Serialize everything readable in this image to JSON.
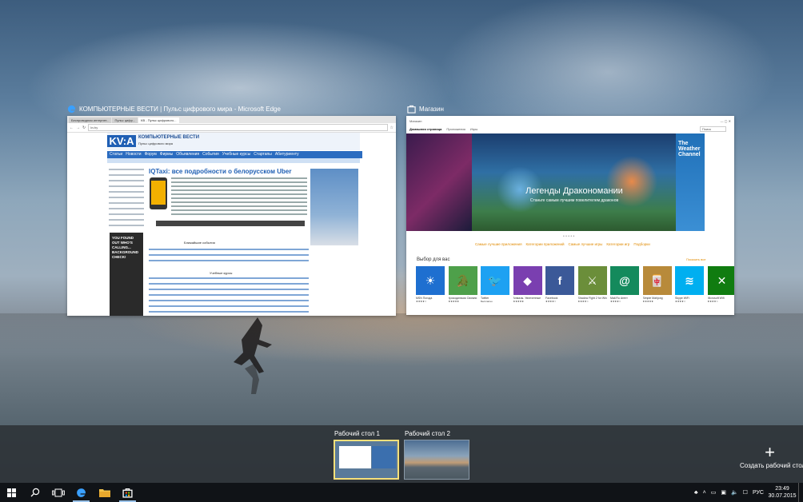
{
  "windows": [
    {
      "title": "КОМПЬЮТЕРНЫЕ ВЕСТИ | Пульс цифрового мира - Microsoft Edge",
      "icon": "edge-icon",
      "content": {
        "tabs": [
          "Беспроводная интернет...",
          "Пульс цифр...",
          "КВ - Пульс цифрового..."
        ],
        "address": "kv.by",
        "logo": "KV:A",
        "site_name": "КОМПЬЮТЕРНЫЕ ВЕСТИ",
        "tagline": "Пульс цифрового мира",
        "nav": [
          "Статьи",
          "Новости",
          "Форум",
          "Фирмы",
          "Объявления",
          "События",
          "Учебные курсы",
          "Стартапы",
          "Абитуриенту"
        ],
        "headline": "IQTaxi: все подробности о белорусском Uber",
        "events_label": "Ближайшие события",
        "courses_label": "Учебные курсы",
        "ad_text": "YOU FOUND OUT WHO'S CALLING... BACKGROUND CHECK!"
      }
    },
    {
      "title": "Магазин",
      "icon": "store-icon",
      "content": {
        "top_left": "Магазин",
        "nav": [
          "Домашняя страница",
          "Приложения",
          "Игры"
        ],
        "search_placeholder": "Поиск",
        "hero_title": "Легенды Дракономании",
        "hero_subtitle": "Станьте самым лучшим повелителем драконов",
        "side_tile": "The Weather Channel",
        "categories": [
          "Самые лучшие приложения",
          "Категории приложений",
          "Самые лучшие игры",
          "Категории игр",
          "Подборки"
        ],
        "for_you_label": "Выбор для вас",
        "show_all": "Показать все",
        "apps": [
          {
            "name": "MSN Погода",
            "rating": "★★★★☆",
            "color": "#1e6fd0",
            "glyph": "☀"
          },
          {
            "name": "Крокодильчик Свомпи 2",
            "rating": "★★★★★",
            "color": "#4ea04a",
            "glyph": "🐊"
          },
          {
            "name": "Twitter",
            "rating": "Бесплатно",
            "color": "#1da1f2",
            "glyph": "🐦"
          },
          {
            "name": "Алмазы. Увлеченные",
            "rating": "★★★★★",
            "color": "#7a3fb0",
            "glyph": "◆"
          },
          {
            "name": "Facebook",
            "rating": "★★★★☆",
            "color": "#3b5998",
            "glyph": "f"
          },
          {
            "name": "Shadow Fight 2 for Windows",
            "rating": "★★★★☆",
            "color": "#6b8e3a",
            "glyph": "⚔"
          },
          {
            "name": "Mail.Ru Агент",
            "rating": "★★★★☆",
            "color": "#148a5c",
            "glyph": "@"
          },
          {
            "name": "Simple Mahjong",
            "rating": "★★★★★",
            "color": "#b88a3a",
            "glyph": "🀄"
          },
          {
            "name": "Skype WiFi",
            "rating": "★★★★☆",
            "color": "#00aff0",
            "glyph": "≋"
          },
          {
            "name": "Microsoft Wifi",
            "rating": "★★★★☆",
            "color": "#107c10",
            "glyph": "✕"
          }
        ]
      }
    }
  ],
  "virtual_desktops": [
    {
      "label": "Рабочий стол 1",
      "active": true
    },
    {
      "label": "Рабочий стол 2",
      "active": false
    }
  ],
  "new_desktop_label": "Создать рабочий стол",
  "taskbar": {
    "icons": [
      "windows-start-icon",
      "search-icon",
      "task-view-icon",
      "edge-icon",
      "file-explorer-icon",
      "store-icon"
    ],
    "language": "РУС",
    "time": "23:49",
    "date": "30.07.2015"
  },
  "colors": {
    "accent_highlight": "#f7e07a",
    "kv_blue": "#1f5fb4",
    "store_orange": "#e08a00",
    "taskbar": "#101317"
  }
}
